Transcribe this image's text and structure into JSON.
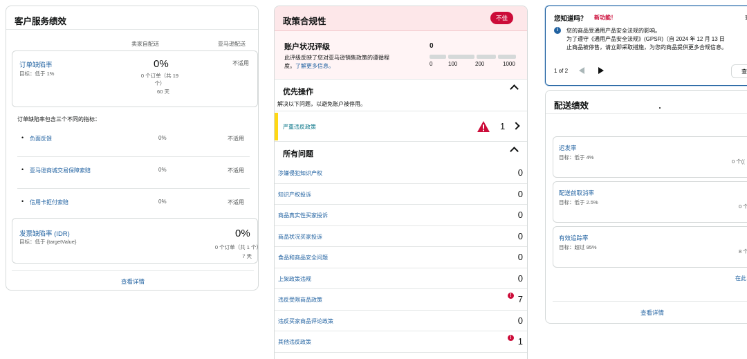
{
  "customer_service": {
    "title": "客户服务绩效",
    "col_fbm": "卖家自配送",
    "col_fba": "亚马逊配送",
    "odr": {
      "name": "订单缺陷率",
      "target": "目标：低于 1%",
      "value": "0%",
      "orders_l1": "0 个订单（共 19",
      "orders_l2": "个）",
      "period": "60 天",
      "fba": "不适用"
    },
    "intro": "订单缺陷率包含三个不同的指标：",
    "sub_metrics": [
      {
        "label": "负面反馈",
        "value": "0%",
        "fba": "不适用"
      },
      {
        "label": "亚马逊商城交易保障索赔",
        "value": "0%",
        "fba": "不适用"
      },
      {
        "label": "信用卡拒付索赔",
        "value": "0%",
        "fba": "不适用"
      }
    ],
    "idr": {
      "name": "发票缺陷率 (IDR)",
      "target": "目标：低于 {targetValue}",
      "value": "0%",
      "orders": "0 个订单（共 1 个）",
      "period": "7 天"
    },
    "view_details": "查看详情"
  },
  "policy": {
    "title": "政策合规性",
    "status_badge": "不佳",
    "account_health": {
      "title": "账户状况评级",
      "desc_l1": "此评级反映了您对亚马逊销售政策的遵循程",
      "desc_l2": "度。",
      "learn_more": "了解更多信息。",
      "score": "0",
      "ticks": [
        "0",
        "100",
        "200",
        "1000"
      ]
    },
    "priority": {
      "title": "优先操作",
      "desc": "解决以下问题，以避免账户被停用。",
      "item_label": "严重违反政策",
      "item_count": "1"
    },
    "all_issues": {
      "title": "所有问题",
      "items": [
        {
          "label": "涉嫌侵犯知识产权",
          "count": "0"
        },
        {
          "label": "知识产权投诉",
          "count": "0"
        },
        {
          "label": "商品真实性买家投诉",
          "count": "0"
        },
        {
          "label": "商品状况买家投诉",
          "count": "0"
        },
        {
          "label": "食品和商品安全问题",
          "count": "0"
        },
        {
          "label": "上架政策违规",
          "count": "0"
        },
        {
          "label": "违反受限商品政策",
          "count": "7",
          "alert": "!"
        },
        {
          "label": "违反买家商品评论政策",
          "count": "0"
        },
        {
          "label": "其他违反政策",
          "count": "1",
          "alert": "!"
        }
      ]
    }
  },
  "did_you_know": {
    "title": "您知道吗？",
    "new_feature": "新功能！",
    "edge_char": "查",
    "line1": "您的商品受通用产品安全法规的影响。",
    "line2": "为了遵守《通用产品安全法规》(GPSR)（自 2024 年 12 月 13 日",
    "line3": "止商品被停售，请立即采取措施，为您的商品提供更多合规信息。",
    "pager": "1 of 2",
    "button": "查"
  },
  "shipping": {
    "title": "配送绩效",
    "metrics": [
      {
        "name": "迟发率",
        "target": "目标：低于 4%",
        "cut": "0 个(("
      },
      {
        "name": "配送前取消率",
        "target": "目标：低于 2.5%",
        "cut": "0 个"
      },
      {
        "name": "有效追踪率",
        "target": "目标：超过 95%",
        "cut": "8 个"
      }
    ],
    "link_cut": "在此",
    "view_details": "查看详情"
  }
}
